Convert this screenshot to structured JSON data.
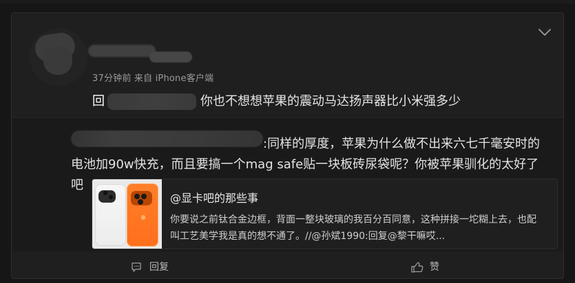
{
  "post": {
    "meta": "37分钟前 来自 iPhone客户端",
    "comment_prefix": "回",
    "comment_text": "你也不想想苹果的震动马达扬声器比小米强多少"
  },
  "reply": {
    "text": ":同样的厚度，苹果为什么做不出来六七千毫安时的电池加90w快充，而且要搞一个mag safe贴一块板砖尿袋呢？你被苹果驯化的太好了吧"
  },
  "link_card": {
    "title": "@显卡吧的那些事",
    "body": "你要说之前钛合金边框，背面一整块玻璃的我百分百同意，这种拼接一坨糊上去，也配叫工艺美学我是真的想不通了。//@孙斌1990:回复@黎干嘛哎..."
  },
  "actions": {
    "reply": "回复",
    "like": "赞"
  },
  "icons": {
    "chevron": "chevron-down-icon",
    "reply": "comment-icon",
    "like": "thumbs-up-icon"
  }
}
